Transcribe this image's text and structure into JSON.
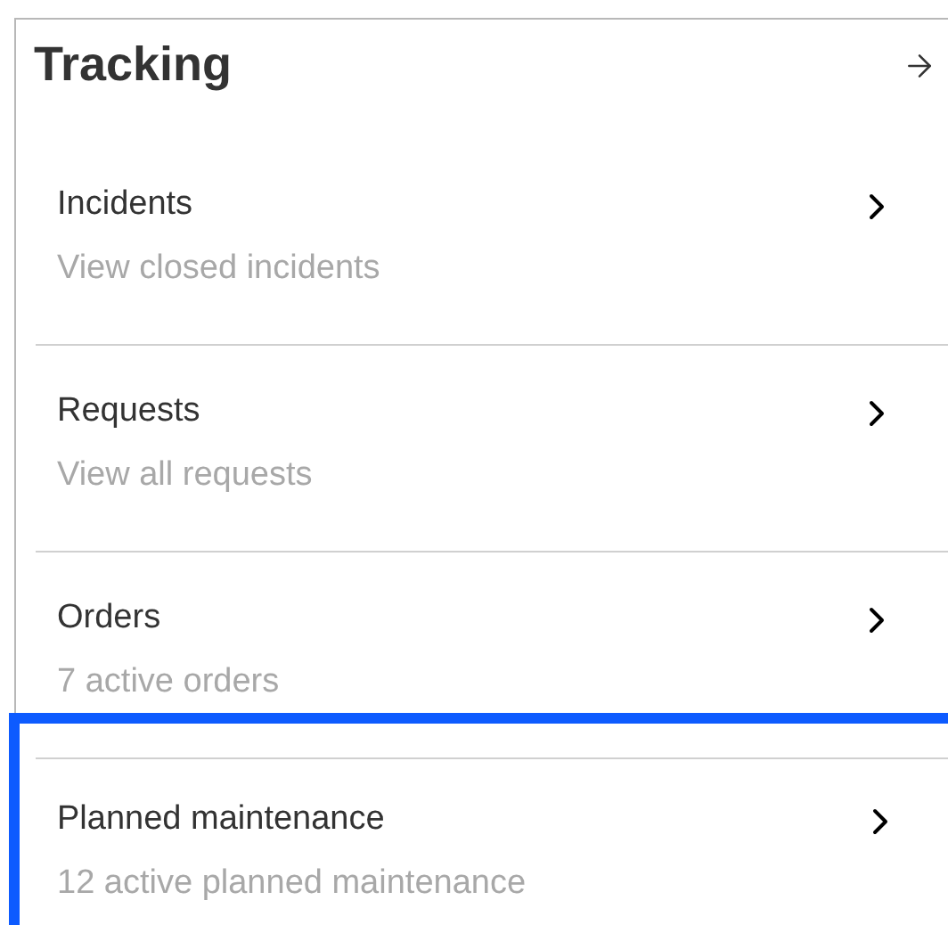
{
  "card": {
    "title": "Tracking"
  },
  "items": [
    {
      "title": "Incidents",
      "subtitle": "View closed incidents",
      "selected": false
    },
    {
      "title": "Requests",
      "subtitle": "View all requests",
      "selected": false
    },
    {
      "title": "Orders",
      "subtitle": "7 active orders",
      "selected": false
    },
    {
      "title": "Planned maintenance",
      "subtitle": "12 active planned maintenance",
      "selected": true
    }
  ]
}
